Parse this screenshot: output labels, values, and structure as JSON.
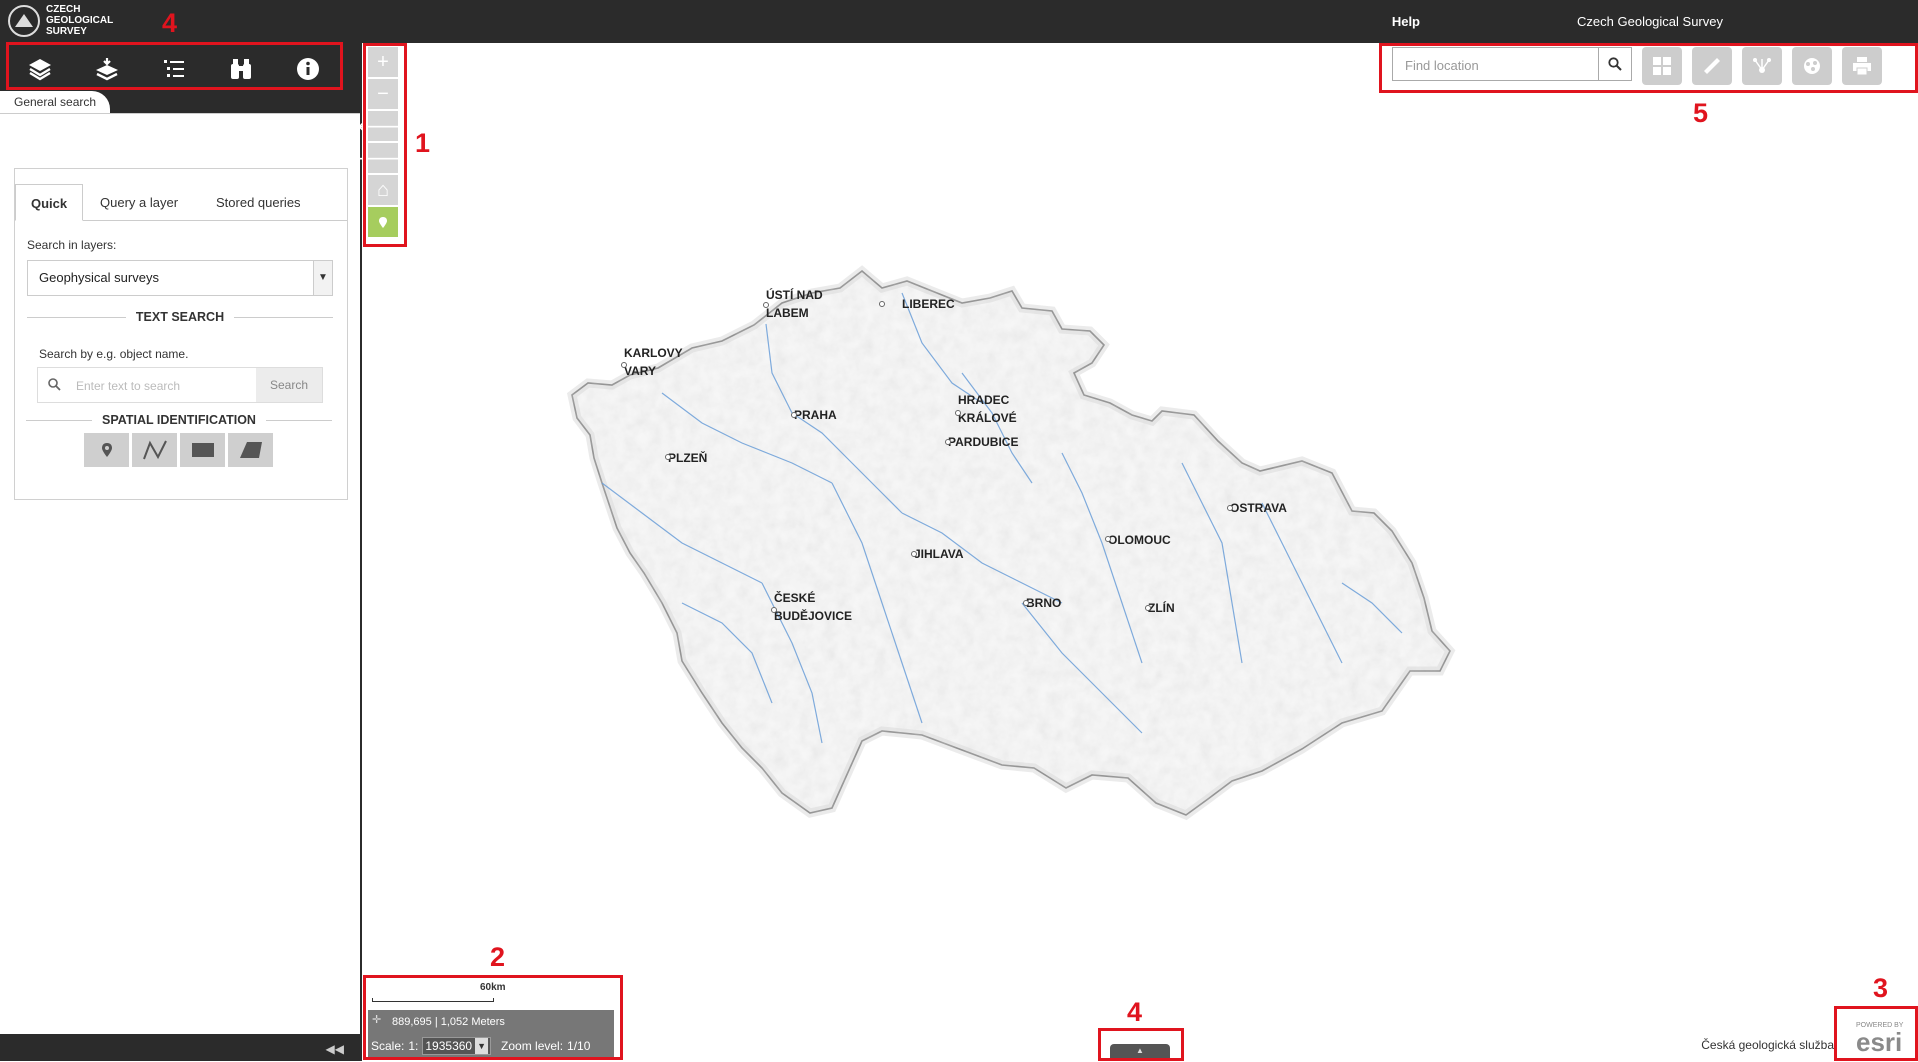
{
  "header": {
    "logo_text": "CZECH GEOLOGICAL SURVEY",
    "help_label": "Help",
    "org_label": "Czech Geological Survey"
  },
  "left_panel": {
    "toolbar_icons": [
      "layers-icon",
      "basemap-icon",
      "legend-icon",
      "binoculars-icon",
      "info-icon"
    ],
    "active_tab": "General search",
    "tabs": [
      {
        "label": "Quick"
      },
      {
        "label": "Query a layer"
      },
      {
        "label": "Stored queries"
      }
    ],
    "search_in_layers_label": "Search in layers:",
    "layer_selected": "Geophysical surveys",
    "text_search_heading": "TEXT SEARCH",
    "text_search_hint": "Search by e.g. object name.",
    "text_search_placeholder": "Enter text to search",
    "search_button": "Search",
    "spatial_heading": "SPATIAL IDENTIFICATION",
    "spatial_tools": [
      "point-icon",
      "polyline-icon",
      "rectangle-icon",
      "polygon-icon"
    ]
  },
  "map": {
    "zoom_controls": [
      "zoom-in-icon",
      "zoom-out-icon",
      "back-icon",
      "forward-icon",
      "home-icon",
      "locate-icon"
    ],
    "find_placeholder": "Find location",
    "tools": [
      "basemap-gallery-icon",
      "measure-icon",
      "share-icon",
      "analysis-icon",
      "print-icon"
    ],
    "cities": [
      {
        "name": "ÚSTÍ NAD LABEM"
      },
      {
        "name": "LIBEREC"
      },
      {
        "name": "KARLOVY VARY"
      },
      {
        "name": "PRAHA"
      },
      {
        "name": "HRADEC KRÁLOVÉ"
      },
      {
        "name": "PARDUBICE"
      },
      {
        "name": "PLZEŇ"
      },
      {
        "name": "OSTRAVA"
      },
      {
        "name": "OLOMOUC"
      },
      {
        "name": "JIHLAVA"
      },
      {
        "name": "ČESKÉ BUDĚJOVICE"
      },
      {
        "name": "BRNO"
      },
      {
        "name": "ZLÍN"
      }
    ],
    "scalebar_label": "60km",
    "coordinates": "889,695 | 1,052 Meters",
    "scale_prefix": "Scale:",
    "scale_ratio_prefix": "1:",
    "scale_value": "1935360",
    "zoom_level_label": "Zoom level:",
    "zoom_level_value": "1/10",
    "attribution": "Česká geologická služba",
    "esri_logo_text": "POWERED BY esri"
  },
  "annotations": [
    "1",
    "2",
    "3",
    "4",
    "4",
    "5"
  ],
  "colors": {
    "header_bg": "#2b2b2b",
    "annotation_red": "#e0141e",
    "rivers": "#6a9ed8",
    "locate_green": "#a6cd5e"
  }
}
